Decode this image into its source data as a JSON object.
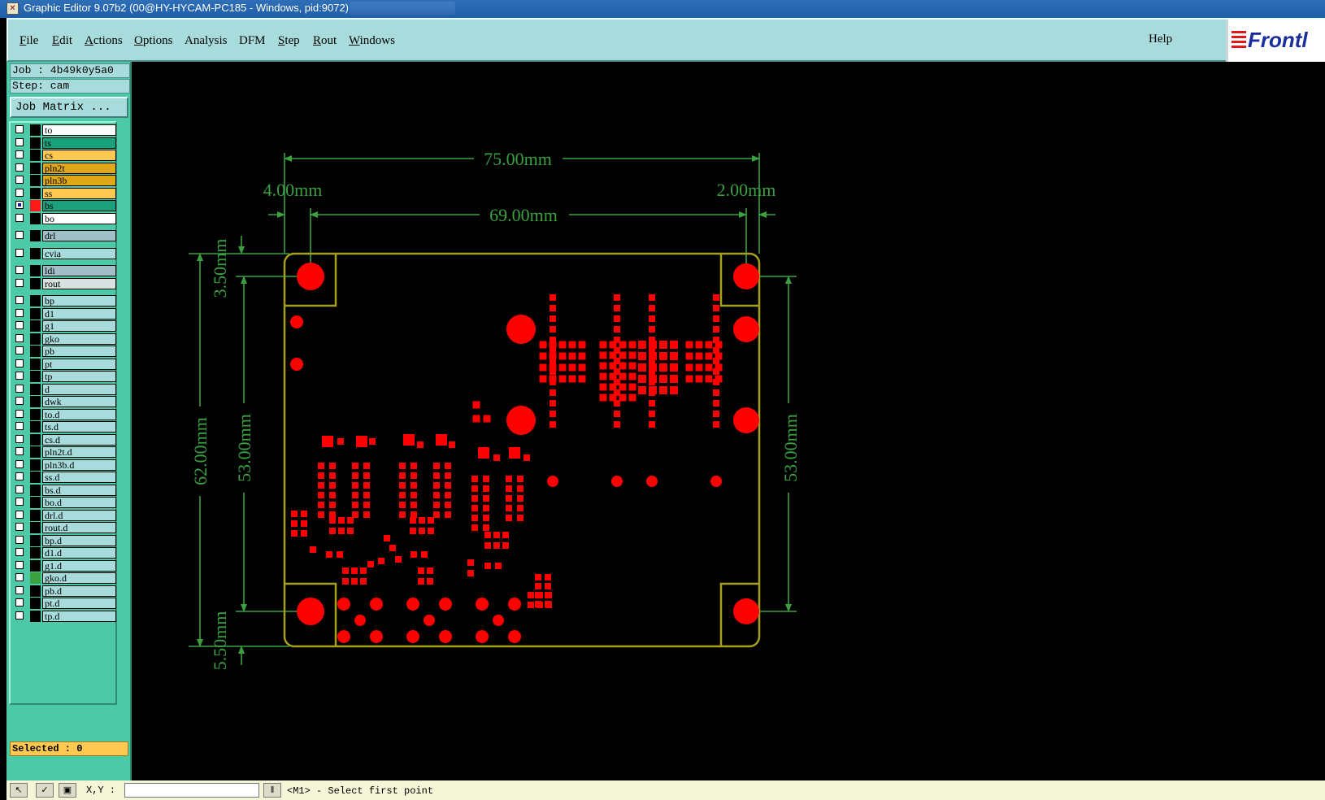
{
  "window": {
    "title": "Graphic Editor 9.07b2 (00@HY-HYCAM-PC185 - Windows, pid:9072)"
  },
  "menu": {
    "items": [
      {
        "label": "File",
        "u": "F",
        "rest": "ile"
      },
      {
        "label": "Edit",
        "u": "E",
        "rest": "dit"
      },
      {
        "label": "Actions",
        "u": "A",
        "rest": "ctions"
      },
      {
        "label": "Options",
        "u": "O",
        "rest": "ptions"
      },
      {
        "label": "Analysis",
        "u": "",
        "rest": "Analysis"
      },
      {
        "label": "DFM",
        "u": "",
        "rest": "DFM"
      },
      {
        "label": "Step",
        "u": "S",
        "rest": "tep"
      },
      {
        "label": "Rout",
        "u": "R",
        "rest": "out"
      },
      {
        "label": "Windows",
        "u": "W",
        "rest": "indows"
      }
    ],
    "help": "Help",
    "logo": "Frontl"
  },
  "info": {
    "job": "Job : 4b49k0y5a0",
    "step": "Step: cam",
    "job_matrix": "Job Matrix ..."
  },
  "layers": [
    {
      "name": "to",
      "color": "#ffffff",
      "swatch": "#000000",
      "checked": false
    },
    {
      "name": "ts",
      "color": "#1ba07c",
      "swatch": "#000000",
      "checked": false
    },
    {
      "name": "cs",
      "color": "#ffc851",
      "swatch": "#000000",
      "checked": false
    },
    {
      "name": "pln2t",
      "color": "#e0a818",
      "swatch": "#000000",
      "checked": false
    },
    {
      "name": "pln3b",
      "color": "#e0a818",
      "swatch": "#000000",
      "checked": false
    },
    {
      "name": "ss",
      "color": "#ffc851",
      "swatch": "#000000",
      "checked": false
    },
    {
      "name": "bs",
      "color": "#1ba07c",
      "swatch": "#ff1a1a",
      "checked": true
    },
    {
      "name": "bo",
      "color": "#ffffff",
      "swatch": "#000000",
      "checked": false
    },
    {
      "name": "drl",
      "color": "#a0bfc8",
      "swatch": "#000000",
      "checked": false
    },
    {
      "name": "cvia",
      "color": "#a8dcdc",
      "swatch": "#000000",
      "checked": false
    },
    {
      "name": "ldi",
      "color": "#a0bfc8",
      "swatch": "#000000",
      "checked": false
    },
    {
      "name": "rout",
      "color": "#d8e0e0",
      "swatch": "#000000",
      "checked": false
    },
    {
      "name": "bp",
      "color": "#a8dcdc",
      "swatch": "#000000",
      "checked": false
    },
    {
      "name": "d1",
      "color": "#a8dcdc",
      "swatch": "#000000",
      "checked": false
    },
    {
      "name": "g1",
      "color": "#a8dcdc",
      "swatch": "#000000",
      "checked": false
    },
    {
      "name": "gko",
      "color": "#a8dcdc",
      "swatch": "#000000",
      "checked": false
    },
    {
      "name": "pb",
      "color": "#a8dcdc",
      "swatch": "#000000",
      "checked": false
    },
    {
      "name": "pt",
      "color": "#a8dcdc",
      "swatch": "#000000",
      "checked": false
    },
    {
      "name": "tp",
      "color": "#a8dcdc",
      "swatch": "#000000",
      "checked": false
    },
    {
      "name": "d",
      "color": "#a8dcdc",
      "swatch": "#000000",
      "checked": false
    },
    {
      "name": "dwk",
      "color": "#a8dcdc",
      "swatch": "#000000",
      "checked": false
    },
    {
      "name": "to.d",
      "color": "#a8dcdc",
      "swatch": "#000000",
      "checked": false
    },
    {
      "name": "ts.d",
      "color": "#a8dcdc",
      "swatch": "#000000",
      "checked": false
    },
    {
      "name": "cs.d",
      "color": "#a8dcdc",
      "swatch": "#000000",
      "checked": false
    },
    {
      "name": "pln2t.d",
      "color": "#a8dcdc",
      "swatch": "#000000",
      "checked": false
    },
    {
      "name": "pln3b.d",
      "color": "#a8dcdc",
      "swatch": "#000000",
      "checked": false
    },
    {
      "name": "ss.d",
      "color": "#a8dcdc",
      "swatch": "#000000",
      "checked": false
    },
    {
      "name": "bs.d",
      "color": "#a8dcdc",
      "swatch": "#000000",
      "checked": false
    },
    {
      "name": "bo.d",
      "color": "#a8dcdc",
      "swatch": "#000000",
      "checked": false
    },
    {
      "name": "drl.d",
      "color": "#a8dcdc",
      "swatch": "#000000",
      "checked": false
    },
    {
      "name": "rout.d",
      "color": "#a8dcdc",
      "swatch": "#000000",
      "checked": false
    },
    {
      "name": "bp.d",
      "color": "#a8dcdc",
      "swatch": "#000000",
      "checked": false
    },
    {
      "name": "d1.d",
      "color": "#a8dcdc",
      "swatch": "#000000",
      "checked": false
    },
    {
      "name": "g1.d",
      "color": "#a8dcdc",
      "swatch": "#000000",
      "checked": false
    },
    {
      "name": "gko.d",
      "color": "#a8dcdc",
      "swatch": "#3aa040",
      "checked": false
    },
    {
      "name": "pb.d",
      "color": "#a8dcdc",
      "swatch": "#000000",
      "checked": false
    },
    {
      "name": "pt.d",
      "color": "#a8dcdc",
      "swatch": "#000000",
      "checked": false
    },
    {
      "name": "tp.d",
      "color": "#a8dcdc",
      "swatch": "#000000",
      "checked": false
    }
  ],
  "selected": "Selected : 0",
  "statusbar": {
    "xy_label": "X,Y :",
    "status": "<M1> - Select first point"
  },
  "dimensions": {
    "overall_width": "75.00mm",
    "left_offset": "4.00mm",
    "right_offset": "2.00mm",
    "hole_span_x": "69.00mm",
    "overall_height": "62.00mm",
    "hole_span_y_left": "53.00mm",
    "hole_span_y_right": "53.00mm",
    "top_offset": "3.50mm",
    "bottom_offset": "5.50mm"
  },
  "colors": {
    "pad": "#ff0000",
    "outline": "#a6a01c",
    "dimension": "#3aa040",
    "panel": "#4ccaa8",
    "menu": "#a8dcdc"
  }
}
